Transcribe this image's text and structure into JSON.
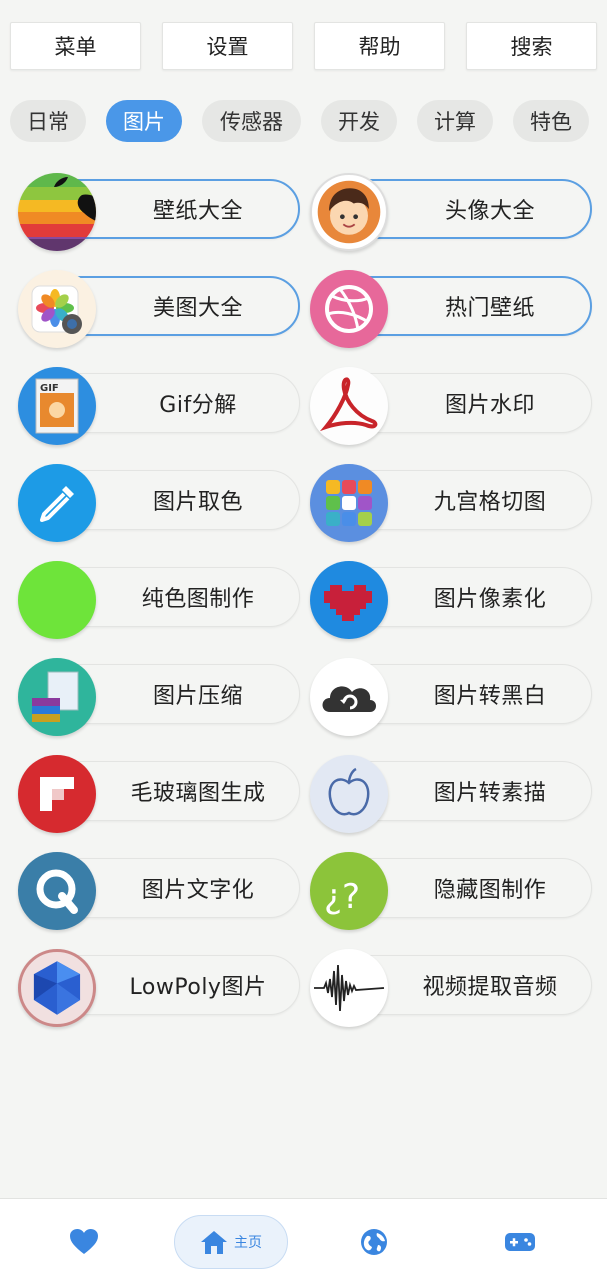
{
  "menu": [
    "菜单",
    "设置",
    "帮助",
    "搜索"
  ],
  "tabs": [
    {
      "label": "日常",
      "active": false
    },
    {
      "label": "图片",
      "active": true
    },
    {
      "label": "传感器",
      "active": false
    },
    {
      "label": "开发",
      "active": false
    },
    {
      "label": "计算",
      "active": false
    },
    {
      "label": "特色",
      "active": false
    }
  ],
  "tools": [
    {
      "label": "壁纸大全",
      "icon": "rainbow-apple-icon"
    },
    {
      "label": "头像大全",
      "icon": "avatar-face-icon"
    },
    {
      "label": "美图大全",
      "icon": "photos-flower-icon"
    },
    {
      "label": "热门壁纸",
      "icon": "dribbble-ball-icon"
    },
    {
      "label": "Gif分解",
      "icon": "gif-file-icon"
    },
    {
      "label": "图片水印",
      "icon": "acrobat-icon"
    },
    {
      "label": "图片取色",
      "icon": "eyedropper-icon"
    },
    {
      "label": "九宫格切图",
      "icon": "nine-grid-icon"
    },
    {
      "label": "纯色图制作",
      "icon": "solid-color-icon"
    },
    {
      "label": "图片像素化",
      "icon": "pixel-heart-icon"
    },
    {
      "label": "图片压缩",
      "icon": "compress-archive-icon"
    },
    {
      "label": "图片转黑白",
      "icon": "cloud-sync-icon"
    },
    {
      "label": "毛玻璃图生成",
      "icon": "flipboard-icon"
    },
    {
      "label": "图片转素描",
      "icon": "sketch-apple-icon"
    },
    {
      "label": "图片文字化",
      "icon": "q-letter-icon"
    },
    {
      "label": "隐藏图制作",
      "icon": "question-marks-icon"
    },
    {
      "label": "LowPoly图片",
      "icon": "low-poly-gem-icon"
    },
    {
      "label": "视频提取音频",
      "icon": "sound-wave-icon"
    }
  ],
  "bottom_nav": {
    "favorites_icon": "heart-icon",
    "home_label": "主页",
    "home_icon": "home-icon",
    "explore_icon": "globe-icon",
    "games_icon": "gamepad-icon"
  },
  "colors": {
    "accent": "#4a97e8",
    "background": "#f4f5f3",
    "highlight_border": "#5b9fe2"
  }
}
